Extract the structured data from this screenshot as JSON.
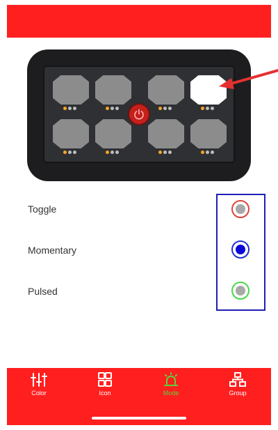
{
  "panel": {
    "buttons": [
      {
        "state": "off",
        "leds": [
          "on",
          "off",
          "off"
        ]
      },
      {
        "state": "off",
        "leds": [
          "on",
          "off",
          "off"
        ]
      },
      {
        "state": "off",
        "leds": [
          "on",
          "off",
          "off"
        ]
      },
      {
        "state": "selected",
        "leds": [
          "on",
          "off",
          "off"
        ]
      },
      {
        "state": "off",
        "leds": [
          "on",
          "off",
          "off"
        ]
      },
      {
        "state": "off",
        "leds": [
          "on",
          "off",
          "off"
        ]
      },
      {
        "state": "off",
        "leds": [
          "on",
          "off",
          "off"
        ]
      },
      {
        "state": "off",
        "leds": [
          "on",
          "off",
          "off"
        ]
      }
    ],
    "power_icon": "power-icon",
    "selection_arrow_color": "#e53030"
  },
  "modes": [
    {
      "label": "Toggle",
      "ring_color": "#e0443a",
      "dot_color": "#a8a8a8",
      "selected": false
    },
    {
      "label": "Momentary",
      "ring_color": "#1f2fd6",
      "dot_color": "#0a0ad8",
      "selected": true
    },
    {
      "label": "Pulsed",
      "ring_color": "#48d848",
      "dot_color": "#a8a8a8",
      "selected": false
    }
  ],
  "tabs": [
    {
      "label": "Color",
      "icon": "sliders-icon",
      "active": false
    },
    {
      "label": "Icon",
      "icon": "grid-icon",
      "active": false
    },
    {
      "label": "Mode",
      "icon": "beacon-icon",
      "active": true
    },
    {
      "label": "Group",
      "icon": "hierarchy-icon",
      "active": false
    }
  ],
  "colors": {
    "header": "#ff1f1f",
    "tabbar": "#ff1f1f",
    "active_tab": "#5ad43a",
    "selection_box": "#1f1fb5"
  }
}
